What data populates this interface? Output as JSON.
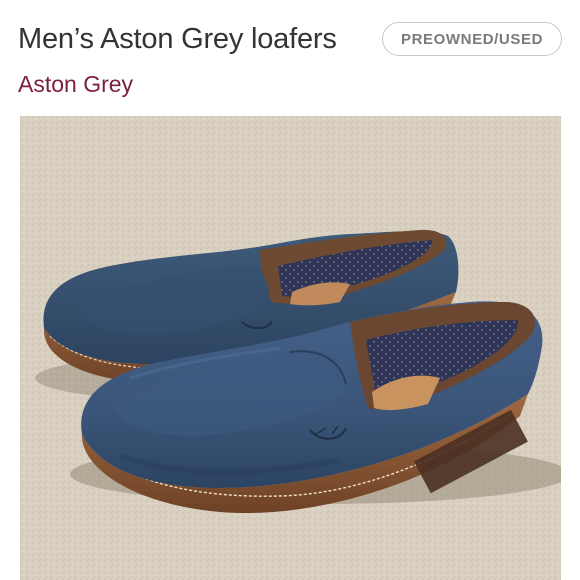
{
  "listing": {
    "title": "Men’s Aston Grey loafers",
    "condition": "PREOWNED/USED",
    "brand": "Aston Grey"
  },
  "photo": {
    "subject": "pair of navy blue suede loafers on beige carpet",
    "colors": {
      "carpet": "#d6cdbd",
      "suede": "#3b5676",
      "suede_dark": "#2b425e",
      "sole": "#8a5a3a",
      "lining": "#c08a5c",
      "insole_pattern": "#2e3556"
    }
  },
  "colors": {
    "title_text": "#333333",
    "brand_accent": "#7a1f3d",
    "badge_text": "#7a7a7a",
    "badge_border": "#c9c9c9"
  }
}
